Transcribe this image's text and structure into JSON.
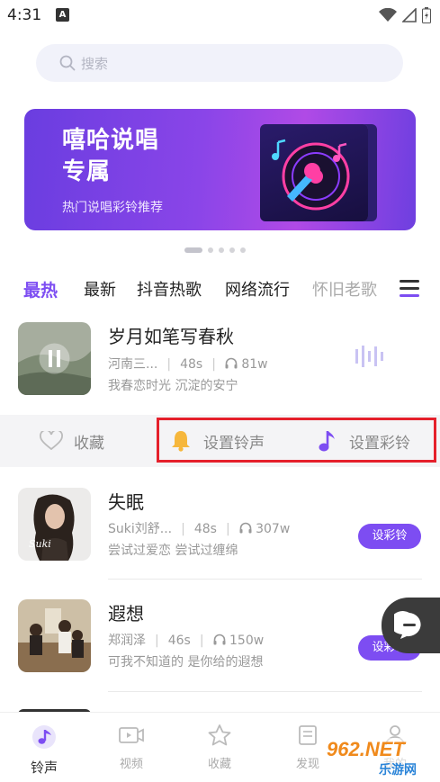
{
  "status": {
    "time": "4:31",
    "notif_glyph": "A"
  },
  "search": {
    "placeholder": "搜索"
  },
  "banner": {
    "title_line1": "嘻哈说唱",
    "title_line2": "专属",
    "subtitle": "热门说唱彩铃推荐"
  },
  "tabs": [
    {
      "label": "最热",
      "active": true
    },
    {
      "label": "最新"
    },
    {
      "label": "抖音热歌"
    },
    {
      "label": "网络流行"
    },
    {
      "label": "怀旧老歌"
    }
  ],
  "songs": [
    {
      "title": "岁月如笔写春秋",
      "artist": "河南三...",
      "duration": "48s",
      "plays": "81w",
      "lyric": "我春恋时光 沉淀的安宁",
      "playing": true
    },
    {
      "title": "失眠",
      "artist": "Suki刘舒...",
      "duration": "48s",
      "plays": "307w",
      "lyric": "尝试过爱恋 尝试过缠绵",
      "button": "设彩铃",
      "cover_text": "Suki"
    },
    {
      "title": "遐想",
      "artist": "郑润泽",
      "duration": "46s",
      "plays": "150w",
      "lyric": "可我不知道的 是你给的遐想",
      "button": "设彩铃"
    }
  ],
  "actions": {
    "favorite": "收藏",
    "set_ringtone": "设置铃声",
    "set_crbt": "设置彩铃"
  },
  "nav": [
    {
      "label": "铃声",
      "icon": "music-note-icon",
      "active": true
    },
    {
      "label": "视频",
      "icon": "video-icon"
    },
    {
      "label": "收藏",
      "icon": "star-icon"
    },
    {
      "label": "发现",
      "icon": "discover-icon"
    },
    {
      "label": "我的",
      "icon": "user-icon"
    }
  ],
  "watermark": {
    "brand": "962.NET",
    "name": "乐游网"
  },
  "colors": {
    "accent": "#7d4df2",
    "highlight_box": "#e5202b",
    "bell": "#f6b73c"
  }
}
